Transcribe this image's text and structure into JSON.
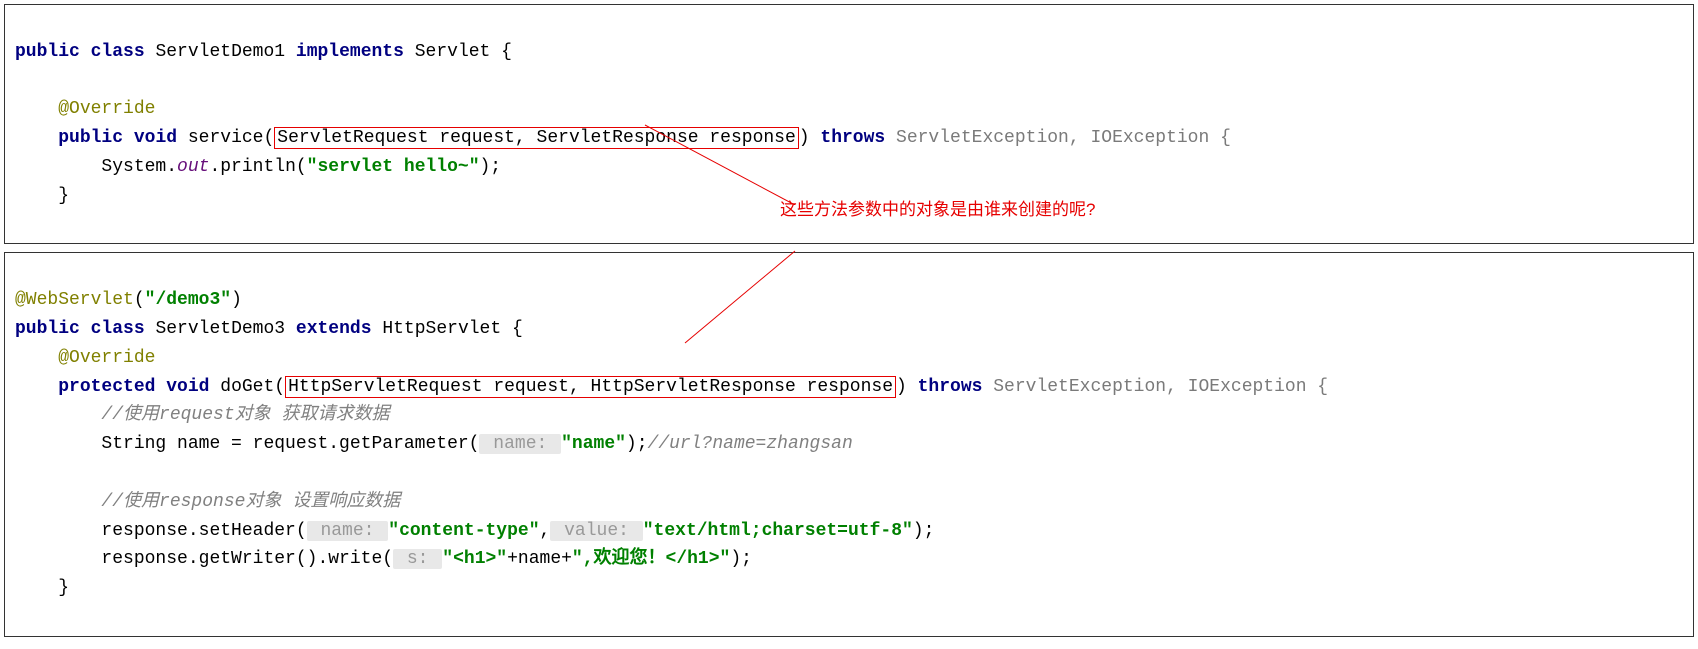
{
  "box1": {
    "l1_public": "public",
    "l1_class": "class",
    "l1_name": "ServletDemo1",
    "l1_implements": "implements",
    "l1_servlet": "Servlet {",
    "l2_anno": "@Override",
    "l3_public": "public",
    "l3_void": "void",
    "l3_method": "service(",
    "l3_params": "ServletRequest request, ServletResponse response",
    "l3_close": ")",
    "l3_throws": "throws",
    "l3_ex": "ServletException, IOException {",
    "l4_sys": "System.",
    "l4_out": "out",
    "l4_println": ".println(",
    "l4_str": "\"servlet hello~\"",
    "l4_end": ");",
    "l5": "    }"
  },
  "box2": {
    "l0_anno": "@WebServlet",
    "l0_paren": "(",
    "l0_str": "\"/demo3\"",
    "l0_close": ")",
    "l1_public": "public",
    "l1_class": "class",
    "l1_name": "ServletDemo3",
    "l1_extends": "extends",
    "l1_http": "HttpServlet {",
    "l2_anno": "@Override",
    "l3_protected": "protected",
    "l3_void": "void",
    "l3_method": "doGet(",
    "l3_params": "HttpServletRequest request, HttpServletResponse response",
    "l3_close": ")",
    "l3_throws": "throws",
    "l3_ex": "ServletException, IOException {",
    "l4_comment": "//使用request对象 获取请求数据",
    "l5_a": "String name = request.getParameter(",
    "l5_hint": " name: ",
    "l5_str": "\"name\"",
    "l5_b": ");",
    "l5_comment": "//url?name=zhangsan",
    "l6_comment": "//使用response对象 设置响应数据",
    "l7_a": "response.setHeader(",
    "l7_hint1": " name: ",
    "l7_str1": "\"content-type\"",
    "l7_mid": ",",
    "l7_hint2": " value: ",
    "l7_str2": "\"text/html;charset=utf-8\"",
    "l7_end": ");",
    "l8_a": "response.getWriter().write(",
    "l8_hint": " s: ",
    "l8_str1": "\"<h1>\"",
    "l8_plus1": "+name+",
    "l8_str2": "\",欢迎您！</h1>\"",
    "l8_end": ");",
    "l9": "    }"
  },
  "callout": "这些方法参数中的对象是由谁来创建的呢?"
}
